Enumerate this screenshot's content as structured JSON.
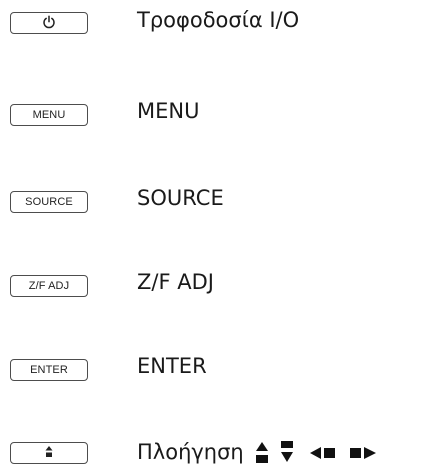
{
  "legend": [
    {
      "key_label": "",
      "key_icon": "power-icon",
      "description": "Τροφοδοσία I/O"
    },
    {
      "key_label": "MENU",
      "description": "MENU"
    },
    {
      "key_label": "SOURCE",
      "description": "SOURCE"
    },
    {
      "key_label": "Z/F ADJ",
      "description": "Z/F ADJ"
    },
    {
      "key_label": "ENTER",
      "description": "ENTER"
    },
    {
      "key_label": "",
      "key_icon": "navigation-arrows-icon",
      "description": "Πλοήγηση"
    }
  ],
  "icons": {
    "row1": "power-icon",
    "row6_key": "navigation-arrows-icon",
    "row6_desc": [
      "up-arrow-icon",
      "down-arrow-icon",
      "left-arrow-icon",
      "right-arrow-icon"
    ]
  },
  "colors": {
    "border": "#4d4d4d",
    "text": "#1a1a1a",
    "background": "#ffffff"
  }
}
